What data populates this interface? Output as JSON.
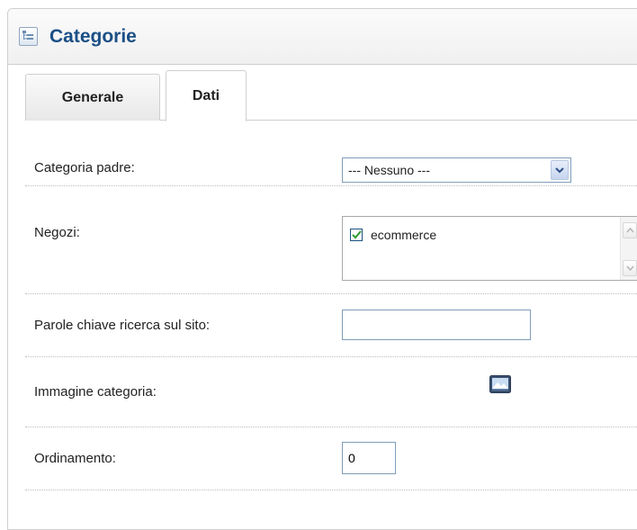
{
  "panel": {
    "title": "Categorie",
    "icon": "category-tree-icon"
  },
  "tabs": [
    {
      "label": "Generale",
      "active": false
    },
    {
      "label": "Dati",
      "active": true
    }
  ],
  "form": {
    "parent_category": {
      "label": "Categoria padre:",
      "selected": "--- Nessuno ---"
    },
    "stores": {
      "label": "Negozi:",
      "items": [
        {
          "label": "ecommerce",
          "checked": true
        }
      ]
    },
    "keywords": {
      "label": "Parole chiave ricerca sul sito:",
      "value": ""
    },
    "image": {
      "label": "Immagine categoria:",
      "icon": "image-picker-icon"
    },
    "sort_order": {
      "label": "Ordinamento:",
      "value": "0"
    }
  },
  "colors": {
    "title": "#1b4f86",
    "border": "#cfcfcf",
    "input_border": "#7f9db9",
    "checkbox_green": "#2e9b2e"
  }
}
